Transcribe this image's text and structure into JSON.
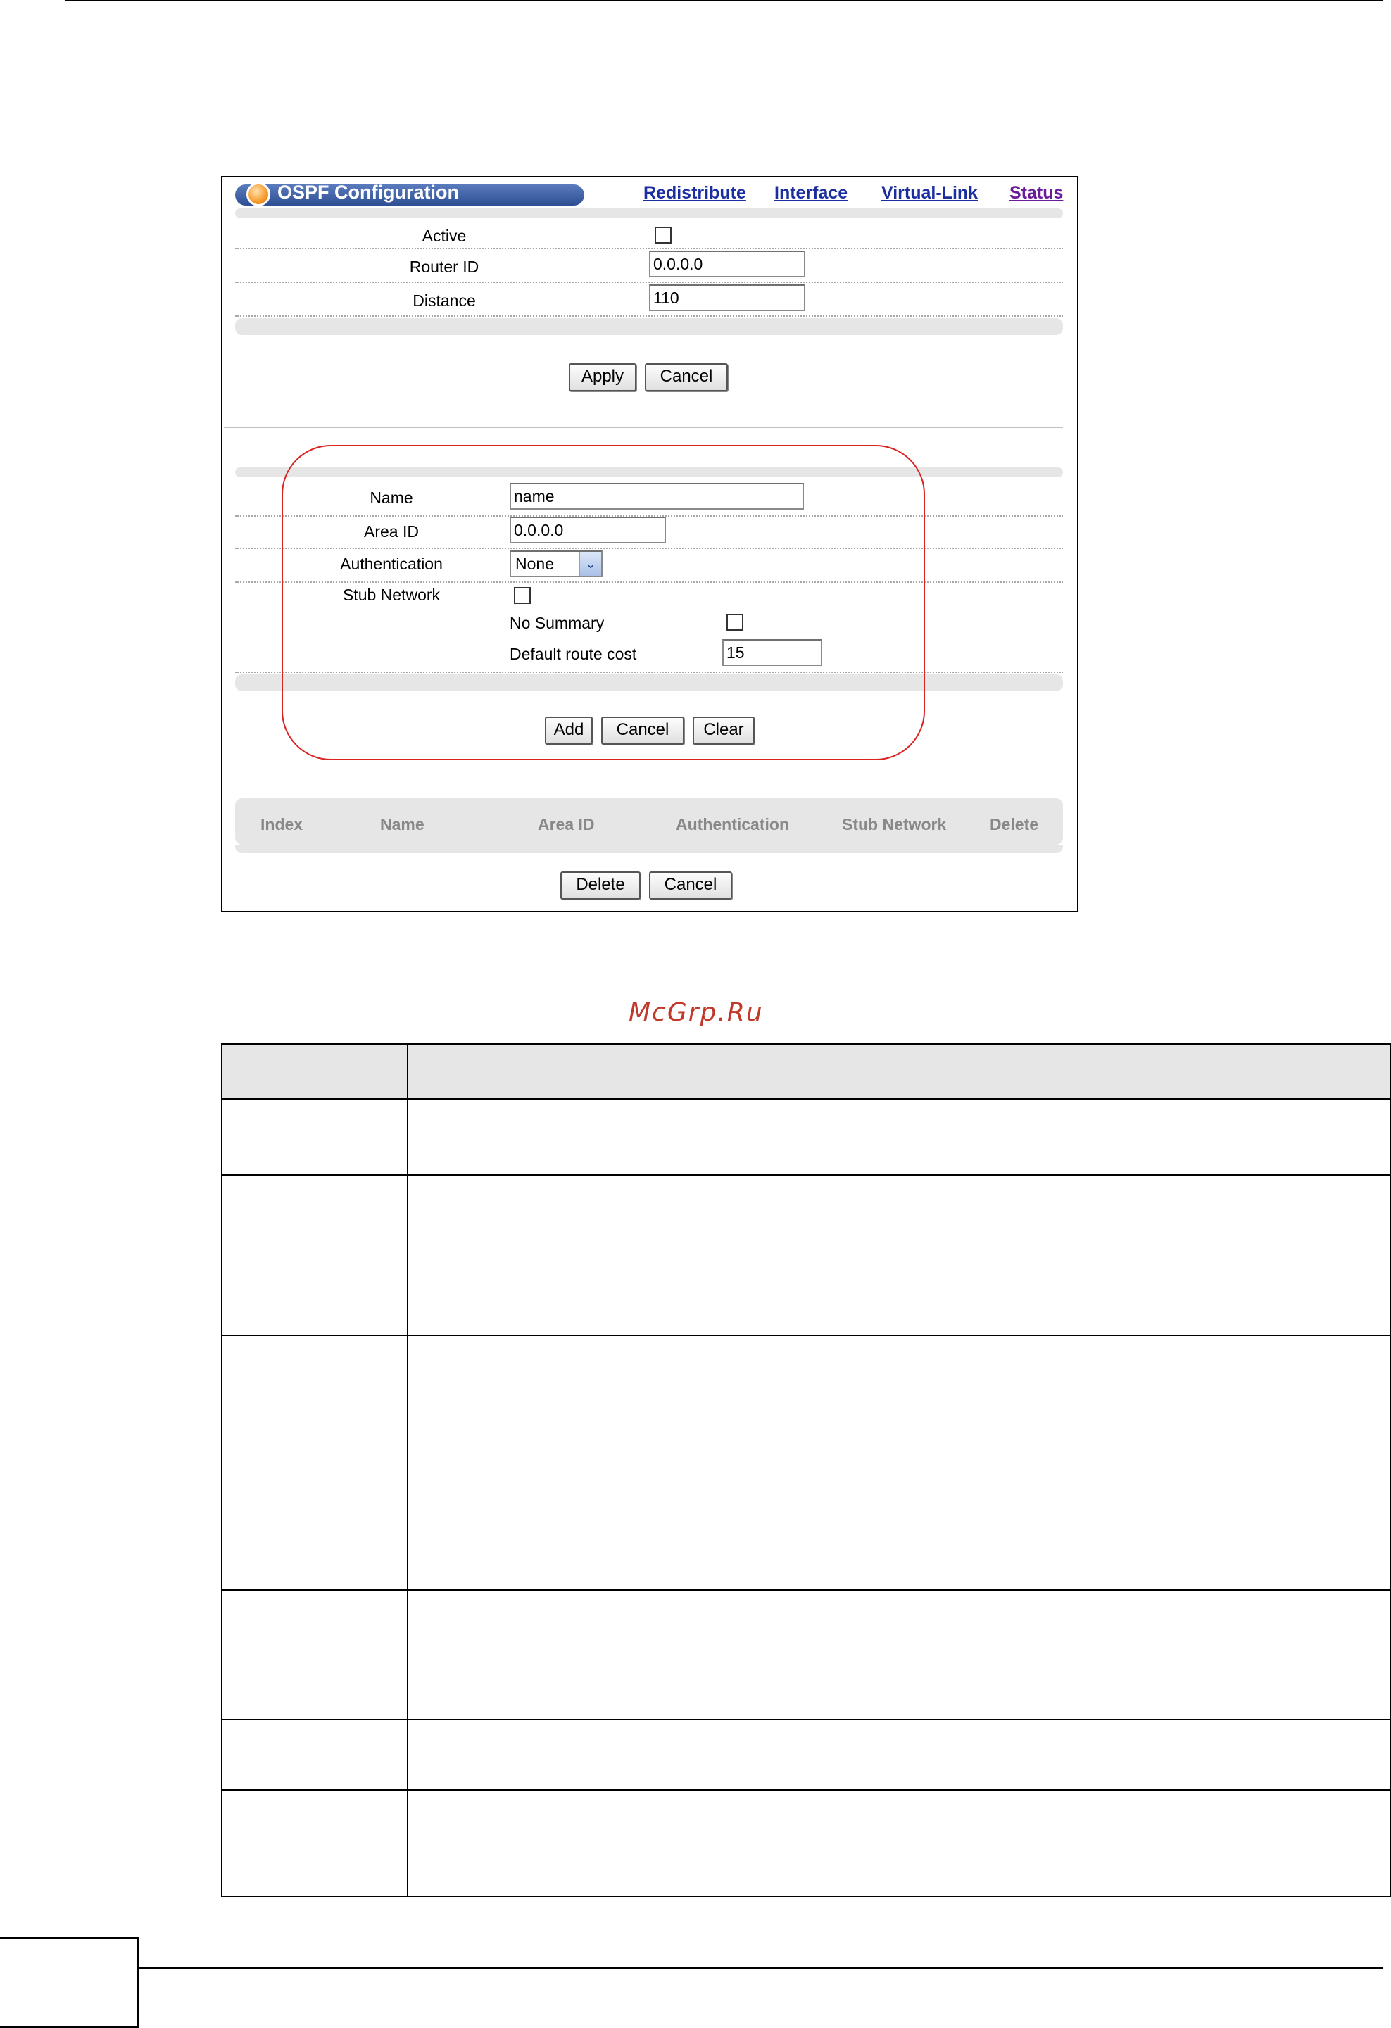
{
  "panel": {
    "title": "OSPF Configuration",
    "nav_links": [
      "Redistribute",
      "Interface",
      "Virtual-Link",
      "Status"
    ],
    "general": {
      "active_label": "Active",
      "router_id_label": "Router ID",
      "router_id_value": "0.0.0.0",
      "distance_label": "Distance",
      "distance_value": "110"
    },
    "general_buttons": {
      "apply": "Apply",
      "cancel": "Cancel"
    },
    "area": {
      "name_label": "Name",
      "name_value": "name",
      "area_id_label": "Area ID",
      "area_id_value": "0.0.0.0",
      "authentication_label": "Authentication",
      "authentication_value": "None",
      "stub_network_label": "Stub Network",
      "no_summary_label": "No Summary",
      "default_route_cost_label": "Default route cost",
      "default_route_cost_value": "15"
    },
    "area_buttons": {
      "add": "Add",
      "cancel": "Cancel",
      "clear": "Clear"
    },
    "table_headers": [
      "Index",
      "Name",
      "Area ID",
      "Authentication",
      "Stub Network",
      "Delete"
    ],
    "table_buttons": {
      "delete": "Delete",
      "cancel": "Cancel"
    }
  },
  "watermark": "McGrp.Ru"
}
